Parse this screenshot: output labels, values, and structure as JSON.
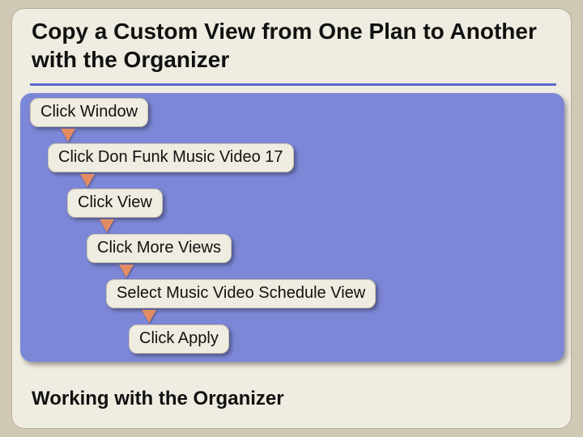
{
  "title": "Copy a Custom View from One Plan to Another with the Organizer",
  "steps": [
    "Click Window",
    "Click Don Funk Music Video 17",
    "Click View",
    "Click More Views",
    "Select Music Video Schedule View",
    "Click Apply"
  ],
  "footer": "Working with the Organizer"
}
